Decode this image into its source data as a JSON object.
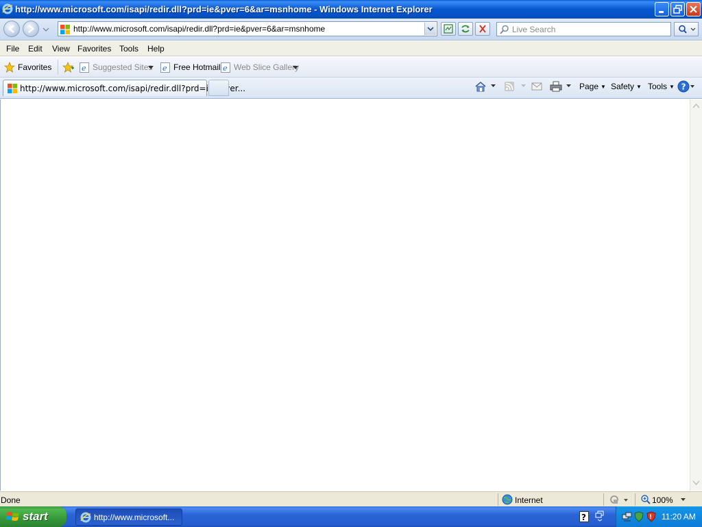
{
  "window": {
    "title": "http://www.microsoft.com/isapi/redir.dll?prd=ie&pver=6&ar=msnhome - Windows Internet Explorer"
  },
  "address_bar": {
    "url": "http://www.microsoft.com/isapi/redir.dll?prd=ie&pver=6&ar=msnhome"
  },
  "search": {
    "placeholder": "Live Search"
  },
  "menu": {
    "items": [
      "File",
      "Edit",
      "View",
      "Favorites",
      "Tools",
      "Help"
    ]
  },
  "favorites_bar": {
    "favorites_label": "Favorites",
    "suggested_sites": "Suggested Sites",
    "free_hotmail": "Free Hotmail",
    "web_slice_gallery": "Web Slice Gallery"
  },
  "tabs": {
    "active_title": "http://www.microsoft.com/isapi/redir.dll?prd=ie&pver..."
  },
  "command_bar": {
    "page": "Page",
    "safety": "Safety",
    "tools": "Tools"
  },
  "status_bar": {
    "status": "Done",
    "zone": "Internet",
    "zoom": "100%"
  },
  "taskbar": {
    "start_label": "start",
    "task_label": "http://www.microsoft...",
    "clock": "11:20 AM"
  },
  "icons": [
    "ie-icon",
    "minimize-icon",
    "restore-icon",
    "close-icon",
    "back-icon",
    "forward-icon",
    "msn-favicon",
    "compatibility-icon",
    "refresh-icon",
    "stop-icon",
    "search-icon",
    "favorites-star-icon",
    "add-favorites-icon",
    "home-icon",
    "rss-icon",
    "read-mail-icon",
    "print-icon",
    "help-icon",
    "globe-icon",
    "protected-mode-icon",
    "zoom-icon",
    "windows-logo-icon"
  ],
  "colors": {
    "titlebar": "#0757d0",
    "taskbar": "#245dd0",
    "start_button": "#35983a",
    "tray": "#0d7bd6"
  }
}
